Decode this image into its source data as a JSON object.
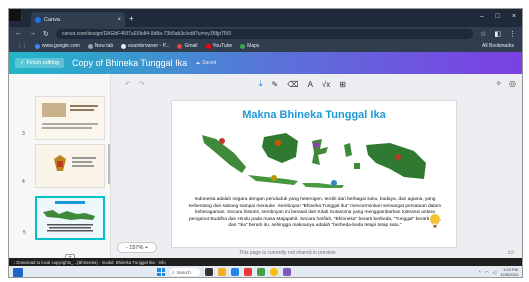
{
  "browser": {
    "tab_title": "Canva",
    "new_tab": "+",
    "window_controls": [
      "–",
      "□",
      "×"
    ],
    "url": "canva.com/design/DAGbF4NI7uE/Ikdf4-9d8a-73b5ab3c/edit?ui=eyJBIjp7fX0",
    "nav_icons": [
      "←",
      "→",
      "↻"
    ],
    "bookmarks": [
      {
        "label": "www.google.com",
        "color": "#4285f4"
      },
      {
        "label": "New tab",
        "color": "#9aa0a6"
      },
      {
        "label": "exambrowser - P...",
        "color": "#e8eaed"
      },
      {
        "label": "Gmail",
        "color": "#ea4335"
      },
      {
        "label": "YouTube",
        "color": "#ff0000"
      },
      {
        "label": "Maps",
        "color": "#34a853"
      }
    ],
    "all_bookmarks": "All Bookmarks"
  },
  "canva": {
    "finish_editing": "Finish editing",
    "doc_title": "Copy of Bhineka Tunggal Ika",
    "saved_status": "Saved",
    "toolbar_icons": [
      "download-icon",
      "draw-icon",
      "eraser-icon",
      "text-icon",
      "formula-icon",
      "grid-icon"
    ],
    "page_numbers": [
      "3",
      "4",
      "5"
    ],
    "zoom": "- 157% +",
    "notes_hint": "This page is currently not shared in preview",
    "header_gradient": [
      "#20b7c7",
      "#7b3fe4"
    ]
  },
  "slide": {
    "title": "Makna Bhineka Tunggal Ika",
    "title_color": "#1c9ad6",
    "body": "Indonesia adalah negara dengan penduduk yang heterogen, terdiri dari berbagai suku, budaya, dan agama, yang terbentang dari sabang sampai merauke. Semboyan \"Bhineka Tunggal Ika\" mencerminkan semangat persatuan dalam keberagaman. Secara historis, semboyan ini berasal dari Kitab Sutasoma yang menggambarkan toleransi antara penganut Buddha dan Hindu pada masa Majapahit. Secara harfiah, \"Bhinneka\" berarti berbeda, \"Tunggal\" berarti satu, dan \"Ika\" berarti itu, sehingga maknanya adalah \"berbeda-beda tetapi tetap satu.\""
  },
  "download_bar": "↓ Download to local copyrights_...(Bhinneka) · modul: Bhineka Tunggal Ika · Info",
  "taskbar": {
    "search_label": "Search",
    "time": "1:03 PM",
    "date": "12/8/2024"
  }
}
